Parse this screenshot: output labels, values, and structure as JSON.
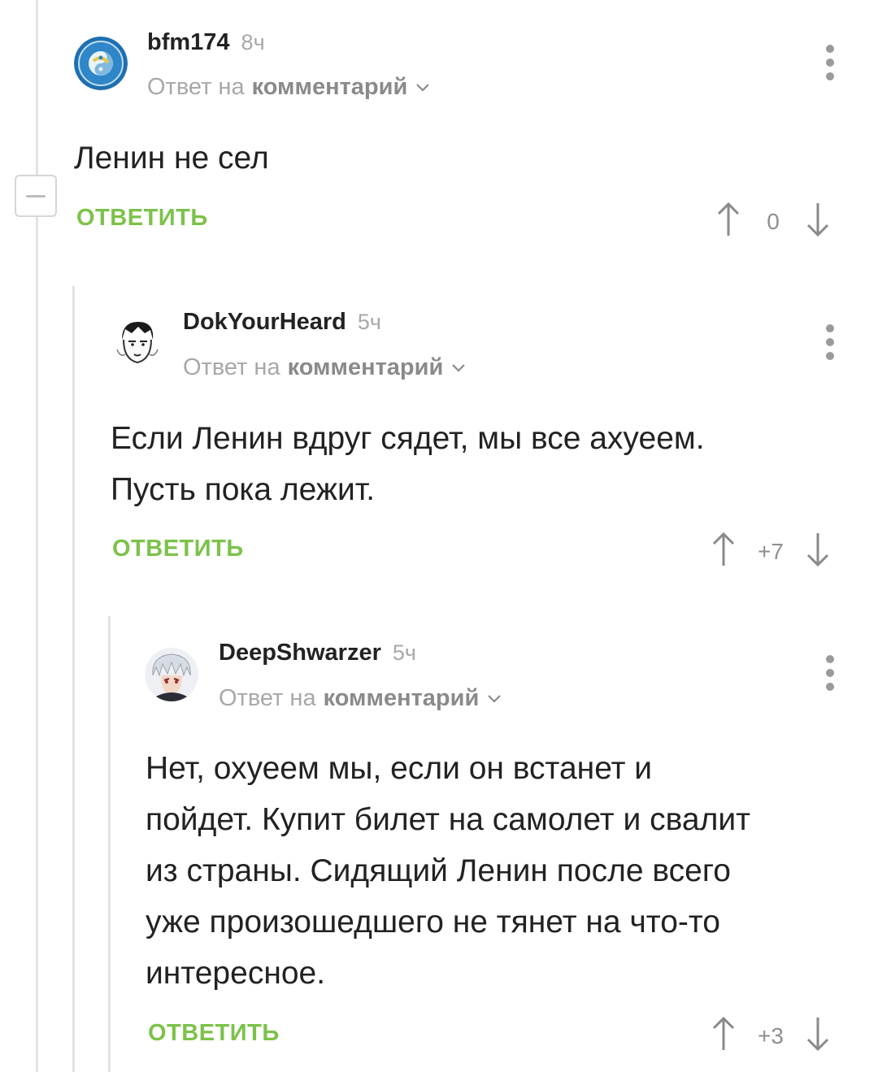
{
  "comments": [
    {
      "username": "bfm174",
      "time": "8ч",
      "reply_prefix": "Ответ на",
      "reply_target": "комментарий",
      "text": "Ленин не сел",
      "reply_label": "ОТВЕТИТЬ",
      "rating": "0"
    },
    {
      "username": "DokYourHeard",
      "time": "5ч",
      "reply_prefix": "Ответ на",
      "reply_target": "комментарий",
      "text_lines": [
        "Если Ленин вдруг сядет, мы все ахуеем.",
        "Пусть пока лежит."
      ],
      "reply_label": "ОТВЕТИТЬ",
      "rating": "+7"
    },
    {
      "username": "DeepShwarzer",
      "time": "5ч",
      "reply_prefix": "Ответ на",
      "reply_target": "комментарий",
      "text_lines": [
        "Нет, охуеем мы, если он встанет и",
        "пойдет. Купит билет на самолет и свалит",
        "из страны. Сидящий Ленин после всего",
        "уже произошедшего не тянет на что-то",
        "интересное."
      ],
      "reply_label": "ОТВЕТИТЬ",
      "rating": "+3"
    }
  ],
  "colors": {
    "accent_green": "#7cc24a",
    "muted_text": "#a8a8a8",
    "thread_line": "#e3e3e3"
  },
  "icons": [
    "collapse-icon",
    "more-vertical-icon",
    "chevron-down-icon",
    "arrow-up-icon",
    "arrow-down-icon"
  ]
}
